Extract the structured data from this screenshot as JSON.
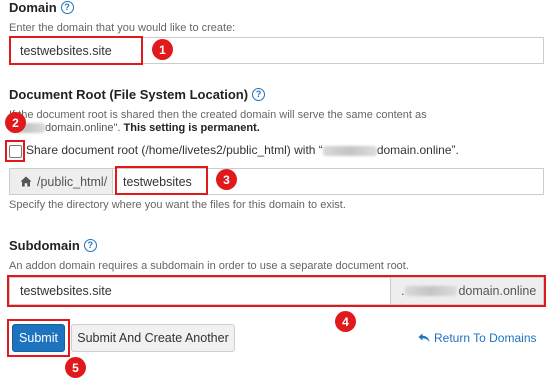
{
  "domain": {
    "label": "Domain",
    "help_text": "Enter the domain that you would like to create:",
    "value": "testwebsites.site"
  },
  "document_root": {
    "label": "Document Root (File System Location)",
    "note_line1": "If the document root is shared then the created domain will serve the same content as",
    "note_line2_suffix": "domain.online\".",
    "note_line2_bold": "This setting is permanent.",
    "share_checkbox_label_start": "Share document root (/home/livetes2/public_html) with “",
    "share_checkbox_label_end": "domain.online”.",
    "share_checked": false,
    "path_prefix": "/public_html/",
    "path_value": "testwebsites",
    "path_help": "Specify the directory where you want the files for this domain to exist."
  },
  "subdomain": {
    "label": "Subdomain",
    "help_text": "An addon domain requires a subdomain in order to use a separate document root.",
    "value": "testwebsites.site",
    "suffix_start": ".",
    "suffix_end": "domain.online"
  },
  "actions": {
    "submit_label": "Submit",
    "submit_another_label": "Submit And Create Another",
    "return_label": "Return To Domains"
  },
  "annotations": [
    "1",
    "2",
    "3",
    "4",
    "5"
  ],
  "colors": {
    "primary": "#1e73be",
    "annotation_red": "#e0191d"
  },
  "icons": {
    "help": "help-circle-icon",
    "home": "home-icon",
    "return": "return-arrow-icon"
  }
}
